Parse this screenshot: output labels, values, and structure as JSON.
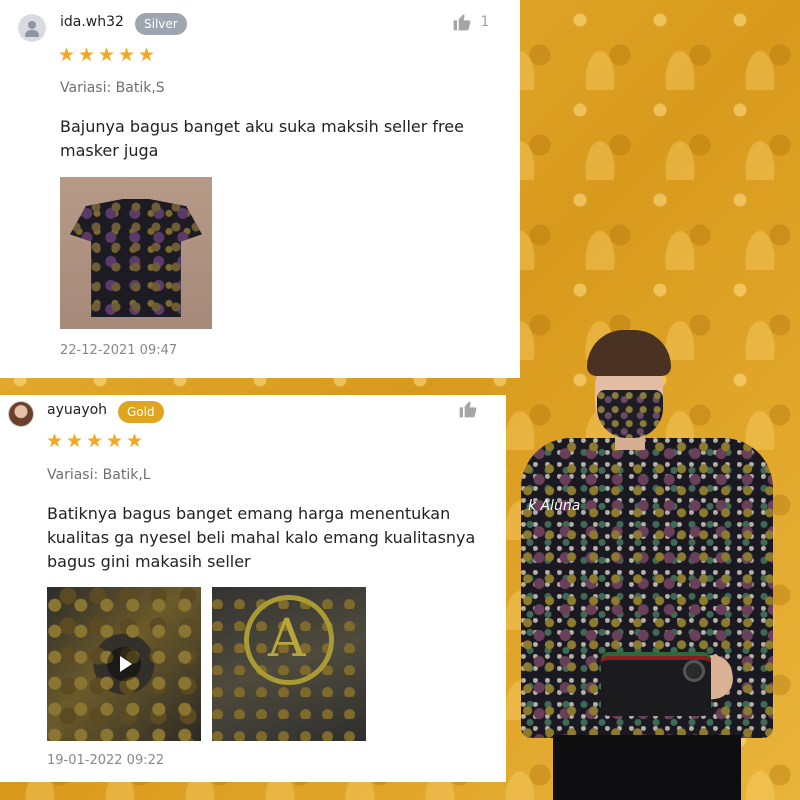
{
  "reviews": [
    {
      "username": "ida.wh32",
      "badge": "Silver",
      "likes": "1",
      "rating": 5,
      "variant": "Variasi: Batik,S",
      "text_line1": "Bajunya bagus banget aku suka maksih seller free",
      "text_line2": "masker juga",
      "timestamp": "22-12-2021 09:47"
    },
    {
      "username": "ayuayoh",
      "badge": "Gold",
      "likes": "",
      "rating": 5,
      "variant": "Variasi: Batik,L",
      "text_line1": "Batiknya bagus banget emang harga menentukan",
      "text_line2": "kualitas ga nyesel beli mahal kalo emang kualitasnya",
      "text_line3": "bagus gini makasih seller",
      "timestamp": "19-01-2022 09:22"
    }
  ],
  "stars": [
    "★",
    "★",
    "★",
    "★",
    "★"
  ],
  "product_photo": {
    "brand_text": "k Aluna"
  },
  "colors": {
    "star": "#f5a623",
    "badge_silver": "#9ea5b0",
    "badge_gold": "#dfa51e",
    "background": "#e2a92b"
  }
}
